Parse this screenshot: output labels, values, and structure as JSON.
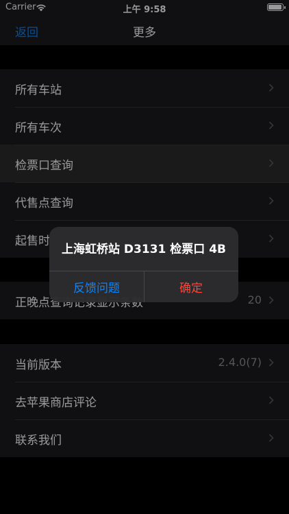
{
  "status_bar": {
    "carrier": "Carrier",
    "time": "上午 9:58",
    "battery_level": 0.95
  },
  "nav": {
    "back_label": "返回",
    "title": "更多"
  },
  "group1": [
    {
      "label": "所有车站"
    },
    {
      "label": "所有车次"
    },
    {
      "label": "检票口查询"
    },
    {
      "label": "代售点查询"
    },
    {
      "label": "起售时"
    }
  ],
  "group2": [
    {
      "label": "正晚点查询记录显示条数",
      "detail": "20"
    }
  ],
  "group3": [
    {
      "label": "当前版本",
      "detail": "2.4.0(7)"
    },
    {
      "label": "去苹果商店评论"
    },
    {
      "label": "联系我们"
    }
  ],
  "alert": {
    "message": "上海虹桥站 D3131 检票口 4B",
    "feedback_label": "反馈问题",
    "confirm_label": "确定"
  },
  "colors": {
    "accent": "#0a84ff",
    "destructive": "#ff453a",
    "background": "#000000",
    "cell": "#1c1c1e"
  }
}
